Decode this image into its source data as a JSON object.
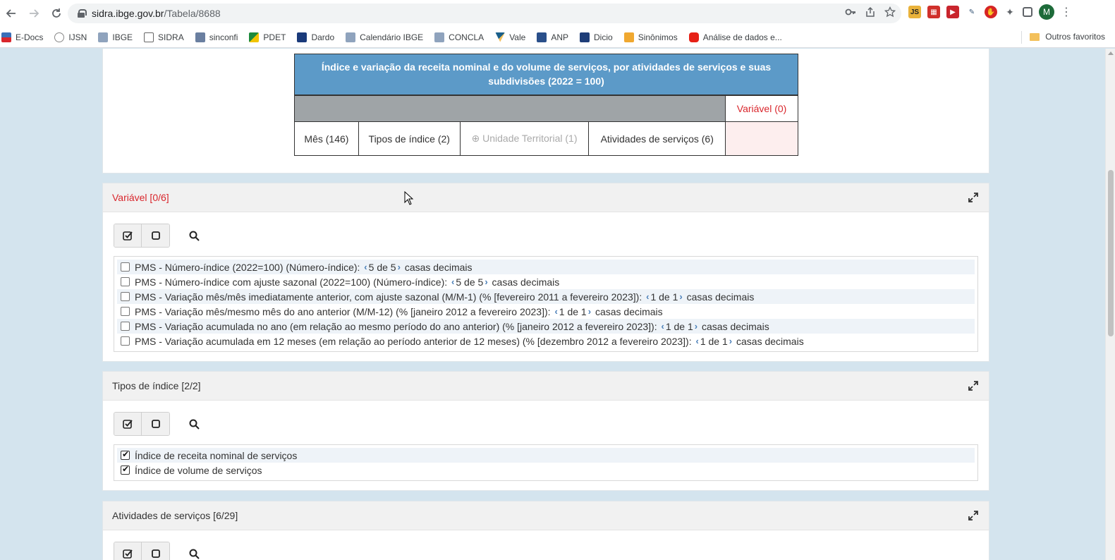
{
  "browser": {
    "url_host": "sidra.ibge.gov.br",
    "url_path": "/Tabela/8688",
    "profile_initial": "M",
    "bookmarks": [
      "E-Docs",
      "IJSN",
      "IBGE",
      "SIDRA",
      "sinconfi",
      "PDET",
      "Dardo",
      "Calendário IBGE",
      "CONCLA",
      "Vale",
      "ANP",
      "Dicio",
      "Sinônimos",
      "Análise de dados e..."
    ],
    "other_bookmarks": "Outros favoritos"
  },
  "layout_table": {
    "title": "Índice e variação da receita nominal e do volume de serviços, por atividades de serviços e suas subdivisões (2022 = 100)",
    "variable_header": "Variável (0)",
    "columns": [
      "Mês (146)",
      "Tipos de índice (2)",
      "Unidade Territorial (1)",
      "Atividades de serviços (6)"
    ]
  },
  "variavel_panel": {
    "title": "Variável [0/6]",
    "items": [
      {
        "label": "PMS - Número-índice (2022=100) (Número-índice):",
        "decimals": "5 de 5",
        "suffix": "casas decimais"
      },
      {
        "label": "PMS - Número-índice com ajuste sazonal (2022=100) (Número-índice):",
        "decimals": "5 de 5",
        "suffix": "casas decimais"
      },
      {
        "label": "PMS - Variação mês/mês imediatamente anterior, com ajuste sazonal (M/M-1) (% [fevereiro 2011 a fevereiro 2023]):",
        "decimals": "1 de 1",
        "suffix": "casas decimais"
      },
      {
        "label": "PMS - Variação mês/mesmo mês do ano anterior (M/M-12) (% [janeiro 2012 a fevereiro 2023]):",
        "decimals": "1 de 1",
        "suffix": "casas decimais"
      },
      {
        "label": "PMS - Variação acumulada no ano (em relação ao mesmo período do ano anterior) (% [janeiro 2012 a fevereiro 2023]):",
        "decimals": "1 de 1",
        "suffix": "casas decimais"
      },
      {
        "label": "PMS - Variação acumulada em 12 meses (em relação ao período anterior de 12 meses) (% [dezembro 2012 a fevereiro 2023]):",
        "decimals": "1 de 1",
        "suffix": "casas decimais"
      }
    ]
  },
  "tipos_panel": {
    "title": "Tipos de índice [2/2]",
    "items": [
      "Índice de receita nominal de serviços",
      "Índice de volume de serviços"
    ]
  },
  "atividades_panel": {
    "title": "Atividades de serviços [6/29]"
  },
  "colors": {
    "accent_red": "#d9262c",
    "header_blue": "#5c9ac8",
    "link_blue": "#4a7fb8"
  }
}
